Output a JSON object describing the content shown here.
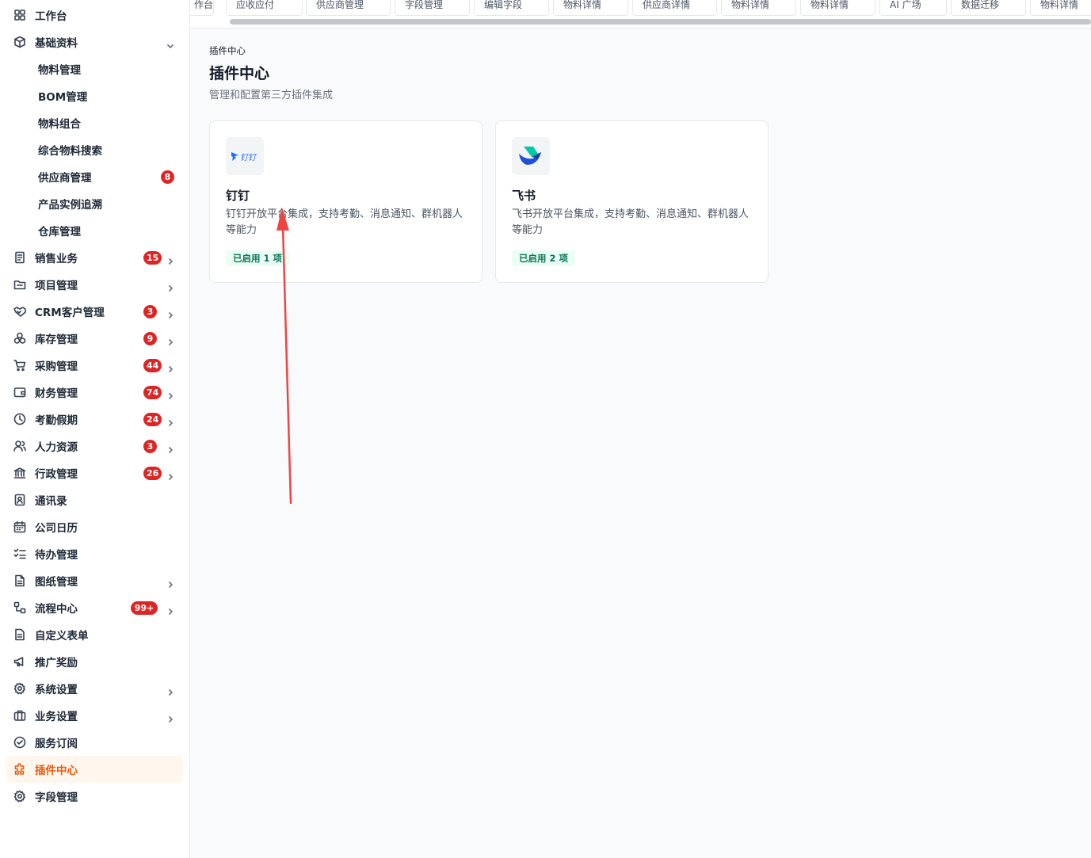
{
  "sidebar": {
    "items": [
      {
        "label": "工作台",
        "icon": "grid-icon"
      },
      {
        "label": "基础资料",
        "icon": "box-icon",
        "expanded": true
      },
      {
        "label": "物料管理"
      },
      {
        "label": "BOM管理"
      },
      {
        "label": "物料组合"
      },
      {
        "label": "综合物料搜索"
      },
      {
        "label": "供应商管理",
        "badge": "8"
      },
      {
        "label": "产品实例追溯"
      },
      {
        "label": "仓库管理"
      },
      {
        "label": "销售业务",
        "icon": "document-icon",
        "badge": "15"
      },
      {
        "label": "项目管理",
        "icon": "folder-icon"
      },
      {
        "label": "CRM客户管理",
        "icon": "handshake-icon",
        "badge": "3"
      },
      {
        "label": "库存管理",
        "icon": "boxes-icon",
        "badge": "9"
      },
      {
        "label": "采购管理",
        "icon": "cart-icon",
        "badge": "44"
      },
      {
        "label": "财务管理",
        "icon": "wallet-icon",
        "badge": "74"
      },
      {
        "label": "考勤假期",
        "icon": "clock-icon",
        "badge": "24"
      },
      {
        "label": "人力资源",
        "icon": "users-icon",
        "badge": "3"
      },
      {
        "label": "行政管理",
        "icon": "bank-icon",
        "badge": "26"
      },
      {
        "label": "通讯录",
        "icon": "contact-icon"
      },
      {
        "label": "公司日历",
        "icon": "calendar-icon"
      },
      {
        "label": "待办管理",
        "icon": "checklist-icon"
      },
      {
        "label": "图纸管理",
        "icon": "file-icon"
      },
      {
        "label": "流程中心",
        "icon": "flow-icon",
        "badge": "99+"
      },
      {
        "label": "自定义表单",
        "icon": "form-icon"
      },
      {
        "label": "推广奖励",
        "icon": "megaphone-icon"
      },
      {
        "label": "系统设置",
        "icon": "gear-icon"
      },
      {
        "label": "业务设置",
        "icon": "briefcase-icon"
      },
      {
        "label": "服务订阅",
        "icon": "check-circle-icon"
      },
      {
        "label": "插件中心",
        "icon": "puzzle-icon",
        "active": true
      },
      {
        "label": "字段管理",
        "icon": "gear-icon"
      }
    ]
  },
  "tabs": [
    "作台",
    "应收应付",
    "供应商管理",
    "字段管理",
    "编辑字段",
    "物料详情",
    "供应商详情",
    "物料详情",
    "物料详情",
    "AI 广场",
    "数据迁移",
    "物料详情"
  ],
  "page": {
    "breadcrumb": "插件中心",
    "title": "插件中心",
    "description": "管理和配置第三方插件集成"
  },
  "plugins": [
    {
      "name": "钉钉",
      "logo_text": "钉钉",
      "description": "钉钉开放平台集成，支持考勤、消息通知、群机器人等能力",
      "status": "已启用 1 项"
    },
    {
      "name": "飞书",
      "description": "飞书开放平台集成，支持考勤、消息通知、群机器人等能力",
      "status": "已启用 2 项"
    }
  ],
  "colors": {
    "accent": "#ea580c",
    "badge": "#dc2626",
    "status_bg": "#ecfdf5",
    "status_text": "#047857",
    "arrow": "#ef4444"
  }
}
